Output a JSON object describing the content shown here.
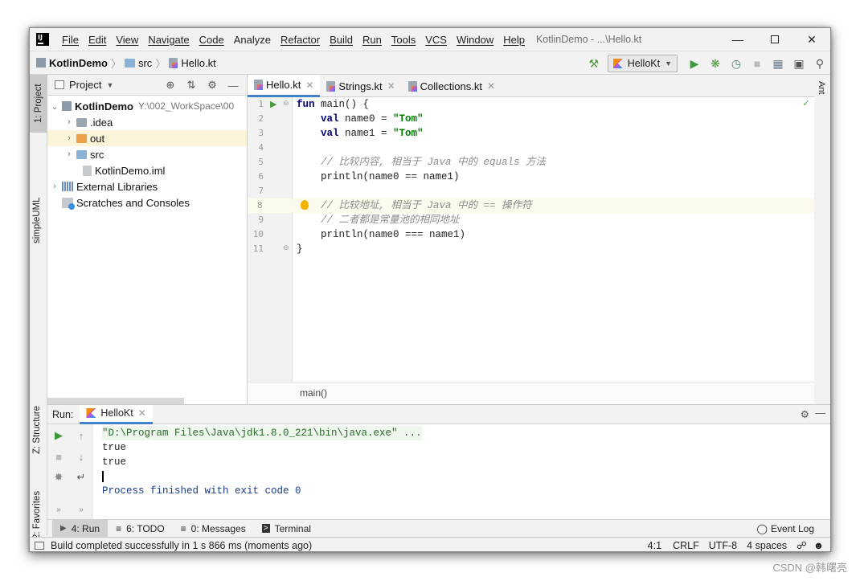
{
  "window": {
    "title": "KotlinDemo - ...\\Hello.kt"
  },
  "menu": [
    "File",
    "Edit",
    "View",
    "Navigate",
    "Code",
    "Analyze",
    "Refactor",
    "Build",
    "Run",
    "Tools",
    "VCS",
    "Window",
    "Help"
  ],
  "breadcrumb": {
    "project": "KotlinDemo",
    "folder": "src",
    "file": "Hello.kt"
  },
  "run_config": "HelloKt",
  "left_stripe": {
    "project": "1: Project",
    "uml": "simpleUML",
    "structure": "Z: Structure",
    "favorites": "2: Favorites"
  },
  "right_stripe": {
    "ant": "Ant"
  },
  "project_panel": {
    "title": "Project",
    "tree": [
      {
        "label": "KotlinDemo",
        "path": "Y:\\002_WorkSpace\\00"
      },
      {
        "label": ".idea"
      },
      {
        "label": "out"
      },
      {
        "label": "src"
      },
      {
        "label": "KotlinDemo.iml"
      },
      {
        "label": "External Libraries"
      },
      {
        "label": "Scratches and Consoles"
      }
    ]
  },
  "editor": {
    "tabs": [
      "Hello.kt",
      "Strings.kt",
      "Collections.kt"
    ],
    "line_numbers": [
      "1",
      "2",
      "3",
      "4",
      "5",
      "6",
      "7",
      "8",
      "9",
      "10",
      "11"
    ],
    "code": {
      "l1_kw": "fun",
      "l1_rest": " main() {",
      "l2_kw": "val",
      "l2_mid": " name0 = ",
      "l2_str": "\"Tom\"",
      "l3_kw": "val",
      "l3_mid": " name1 = ",
      "l3_str": "\"Tom\"",
      "l5": "// 比较内容, 相当于 Java 中的 equals 方法",
      "l6": "println(name0 == name1)",
      "l8": "// 比较地址, 相当于 Java 中的 == 操作符",
      "l9": "// 二者都是常量池的相同地址",
      "l10": "println(name0 === name1)",
      "l11": "}"
    },
    "breadcrumb": "main()"
  },
  "run_panel": {
    "label": "Run:",
    "tab": "HelloKt",
    "output": [
      "\"D:\\Program Files\\Java\\jdk1.8.0_221\\bin\\java.exe\" ...",
      "true",
      "true",
      "",
      "Process finished with exit code 0"
    ]
  },
  "bottom_tabs": {
    "run": "4: Run",
    "todo": "6: TODO",
    "messages": "0: Messages",
    "terminal": "Terminal",
    "event_log": "Event Log"
  },
  "status": {
    "message": "Build completed successfully in 1 s 866 ms (moments ago)",
    "position": "4:1",
    "line_sep": "CRLF",
    "encoding": "UTF-8",
    "indent": "4 spaces"
  },
  "watermark": "CSDN @韩曙亮"
}
